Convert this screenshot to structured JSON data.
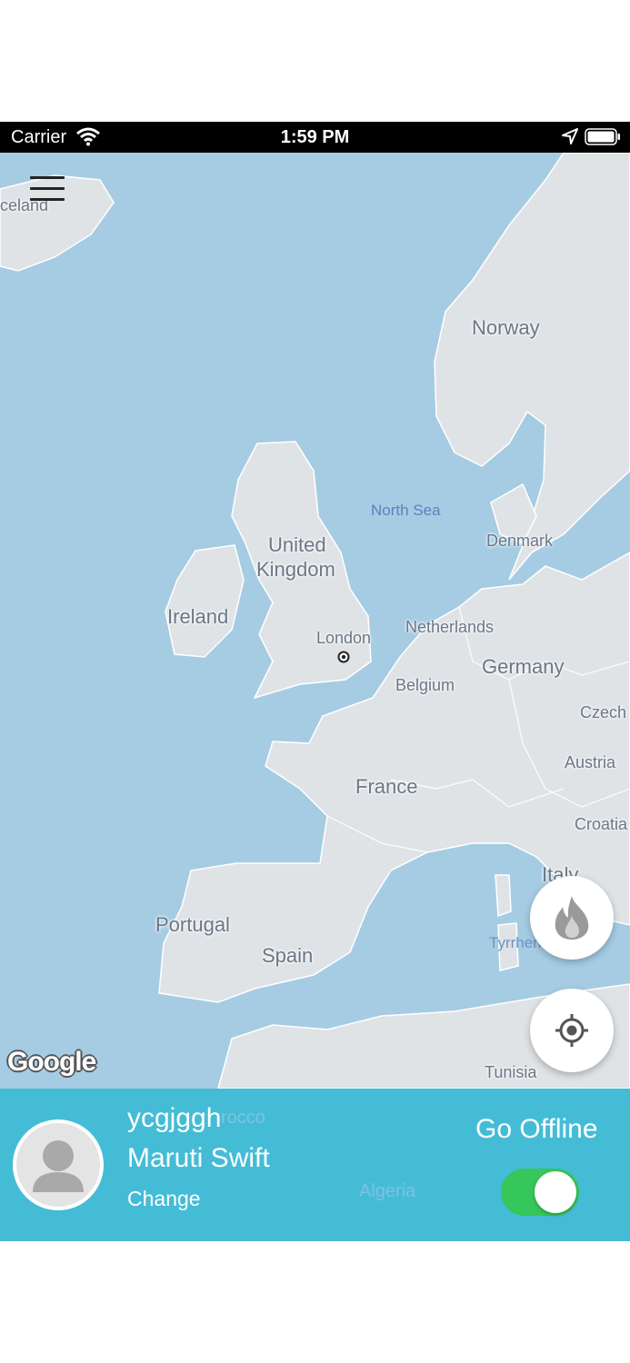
{
  "status_bar": {
    "carrier": "Carrier",
    "time": "1:59 PM",
    "icons": [
      "wifi-icon",
      "location-arrow-icon",
      "battery-icon"
    ]
  },
  "map": {
    "attribution": "Google",
    "labels": {
      "iceland": "celand",
      "norway": "Norway",
      "north_sea": "North Sea",
      "denmark": "Denmark",
      "united": "United",
      "kingdom": "Kingdom",
      "ireland": "Ireland",
      "london": "London",
      "netherlands": "Netherlands",
      "germany": "Germany",
      "belgium": "Belgium",
      "czech": "Czech",
      "austria": "Austria",
      "france": "France",
      "croatia": "Croatia",
      "italy": "Italy",
      "portugal": "Portugal",
      "spain": "Spain",
      "tyrrhenian": "Tyrrhen",
      "tunisia": "Tunisia",
      "morocco": "rocco",
      "algeria": "Algeria"
    },
    "colors": {
      "water": "#a6cce4",
      "land": "#dfe3e6"
    }
  },
  "controls": {
    "menu_icon": "hamburger-menu-icon",
    "heatmap_icon": "flame-icon",
    "locate_icon": "crosshair-icon"
  },
  "driver": {
    "name": "ycgjggh",
    "car": "Maruti Swift",
    "change_label": "Change",
    "status_label": "Go Offline",
    "online": true
  },
  "theme": {
    "panel": "#45bcd6",
    "toggle_on": "#35c759"
  }
}
